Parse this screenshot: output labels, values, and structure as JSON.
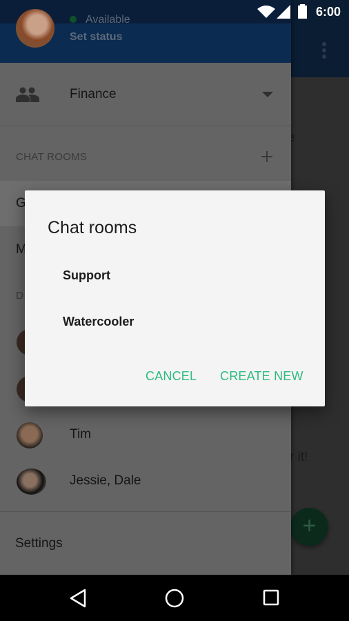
{
  "status_bar": {
    "time": "6:00",
    "icons": [
      "wifi-icon",
      "signal-icon",
      "battery-icon"
    ]
  },
  "background": {
    "fragments": [
      "e",
      "s",
      "r it!"
    ],
    "fab_icon": "plus-icon",
    "overflow_icon": "more-vert-icon"
  },
  "drawer": {
    "profile": {
      "status": "Available",
      "set_status": "Set status",
      "status_color": "#10502a"
    },
    "account": {
      "label": "Finance",
      "icon": "people-icon"
    },
    "chat_rooms_header": "CHAT ROOMS",
    "partial_items": [
      "G",
      "M"
    ],
    "dm_header_partial": "D",
    "dms": [
      {
        "name": "Tim"
      },
      {
        "name": "Jessie, Dale"
      }
    ],
    "settings": "Settings"
  },
  "dialog": {
    "title": "Chat rooms",
    "items": [
      "Support",
      "Watercooler"
    ],
    "cancel": "CANCEL",
    "create_new": "CREATE NEW",
    "accent": "#2dbb80"
  },
  "nav_bar": {
    "icons": [
      "back-icon",
      "home-icon",
      "recents-icon"
    ]
  }
}
